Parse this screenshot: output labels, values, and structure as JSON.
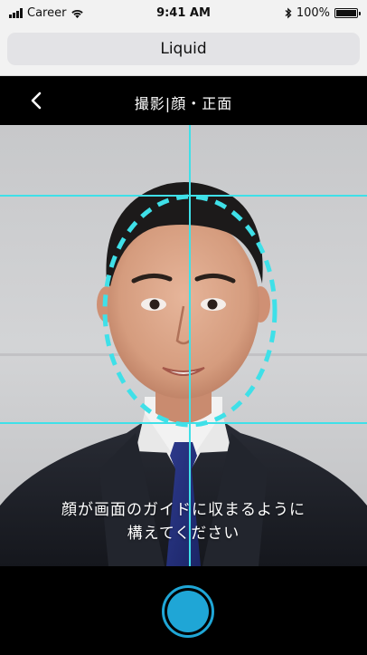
{
  "status_bar": {
    "carrier": "Career",
    "time": "9:41 AM",
    "battery_percent": "100%",
    "bluetooth_icon": "bluetooth-icon",
    "wifi_icon": "wifi-icon",
    "battery_level": 1.0
  },
  "browser": {
    "url_title": "Liquid"
  },
  "header": {
    "title": "撮影|顔・正面",
    "back_icon": "chevron-left-icon"
  },
  "camera": {
    "instruction_line1": "顔が画面のガイドに収まるように",
    "instruction_line2": "構えてください",
    "guide_color": "#3fe0e8"
  },
  "shutter": {
    "color": "#1fa6d6",
    "icon": "shutter-button"
  }
}
